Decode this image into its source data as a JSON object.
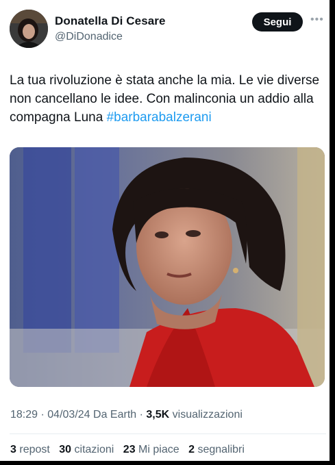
{
  "author": {
    "name": "Donatella Di Cesare",
    "handle": "@DiDonadice"
  },
  "follow_label": "Segui",
  "more_icon": "more-horizontal-icon",
  "tweet": {
    "text": "La tua rivoluzione è stata anche la mia. Le vie diverse non cancellano le idee. Con malinconia un addio alla compagna Luna ",
    "hashtag": "#barbarabalzerani"
  },
  "meta": {
    "time": "18:29",
    "date": "04/03/24",
    "source": "Da Earth",
    "views_count": "3,5K",
    "views_label": "visualizzazioni",
    "separator": "·"
  },
  "stats": {
    "reposts": {
      "count": "3",
      "label": "repost"
    },
    "quotes": {
      "count": "30",
      "label": "citazioni"
    },
    "likes": {
      "count": "23",
      "label": "Mi piace"
    },
    "bookmarks": {
      "count": "2",
      "label": "segnalibri"
    }
  },
  "colors": {
    "text": "#0f1419",
    "secondary": "#536471",
    "link": "#1d9bf0",
    "button_bg": "#0f1419",
    "divider": "#e6ecf0"
  }
}
